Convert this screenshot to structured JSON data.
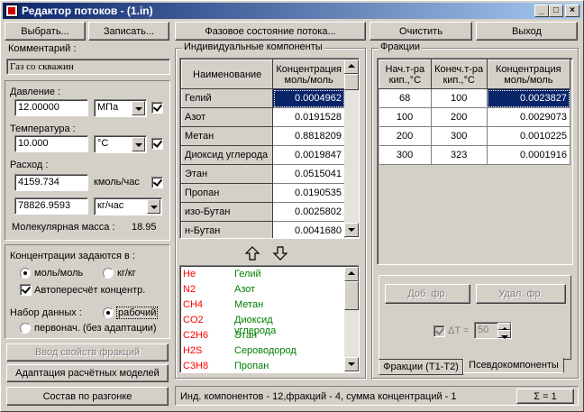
{
  "window": {
    "title": "Редактор потоков - (1.in)"
  },
  "toolbar": {
    "select": "Выбрать...",
    "save": "Записать...",
    "phase_state": "Фазовое состояние потока...",
    "clear": "Очистить",
    "exit": "Выход"
  },
  "left": {
    "comment_label": "Комментарий :",
    "comment_value": "Газ со скважин",
    "pressure_label": "Давление :",
    "pressure_value": "12.00000",
    "pressure_unit": "МПа",
    "temperature_label": "Температура :",
    "temperature_value": "10.000",
    "temperature_unit": "°C",
    "flow_label": "Расход :",
    "flow_value_1": "4159.734",
    "flow_unit_1": "кмоль/час",
    "flow_value_2": "78826.9593",
    "flow_unit_2": "кг/час",
    "molar_mass_label": "Молекулярная масса :",
    "molar_mass_value": "18.95",
    "conc_label": "Концентрации задаются в :",
    "conc_opt_mol": "моль/моль",
    "conc_opt_kg": "кг/кг",
    "auto_recalc": "Автопересчёт концентр.",
    "dataset_label": "Набор данных :",
    "dataset_working": "рабочий",
    "dataset_initial": "первонач. (без адаптации)",
    "btn_fraction_props": "Ввод свойств фракций",
    "btn_adapt_models": "Адаптация расчётных моделей",
    "btn_composition": "Состав по разгонке"
  },
  "components": {
    "group_title": "Индивидуальные компоненты",
    "col_name": "Наименование",
    "col_conc_1": "Концентрация",
    "col_conc_2": "моль/моль",
    "rows": [
      {
        "name": "Гелий",
        "value": "0.0004962"
      },
      {
        "name": "Азот",
        "value": "0.0191528"
      },
      {
        "name": "Метан",
        "value": "0.8818209"
      },
      {
        "name": "Диоксид углерода",
        "value": "0.0019847"
      },
      {
        "name": "Этан",
        "value": "0.0515041"
      },
      {
        "name": "Пропан",
        "value": "0.0190535"
      },
      {
        "name": "изо-Бутан",
        "value": "0.0025802"
      },
      {
        "name": "н-Бутан",
        "value": "0.0041680"
      }
    ],
    "library": [
      {
        "formula": "He",
        "name": "Гелий"
      },
      {
        "formula": "N2",
        "name": "Азот"
      },
      {
        "formula": "CH4",
        "name": "Метан"
      },
      {
        "formula": "CO2",
        "name": "Диоксид углерода"
      },
      {
        "formula": "C2H6",
        "name": "Этан"
      },
      {
        "formula": "H2S",
        "name": "Сероводород"
      },
      {
        "formula": "C3H8",
        "name": "Пропан"
      }
    ]
  },
  "fractions": {
    "group_title": "Фракции",
    "col_start_1": "Нач.т-ра",
    "col_start_2": "кип.,°C",
    "col_end_1": "Конеч.т-ра",
    "col_end_2": "кип.,°C",
    "col_conc_1": "Концентрация",
    "col_conc_2": "моль/моль",
    "rows": [
      {
        "start": "68",
        "end": "100",
        "value": "0.0023827"
      },
      {
        "start": "100",
        "end": "200",
        "value": "0.0029073"
      },
      {
        "start": "200",
        "end": "300",
        "value": "0.0010225"
      },
      {
        "start": "300",
        "end": "323",
        "value": "0.0001916"
      }
    ],
    "btn_add": "Доб. фр.",
    "btn_remove": "Удал. фр.",
    "delta_label": "ΔT =",
    "delta_value": "50",
    "tab_fractions": "Фракции (Т1-Т2)",
    "tab_pseudo": "Псевдокомпоненты"
  },
  "status": {
    "text": "Инд. компонентов - 12,фракций - 4,     сумма концентраций - 1",
    "sum_button": "Σ = 1"
  }
}
